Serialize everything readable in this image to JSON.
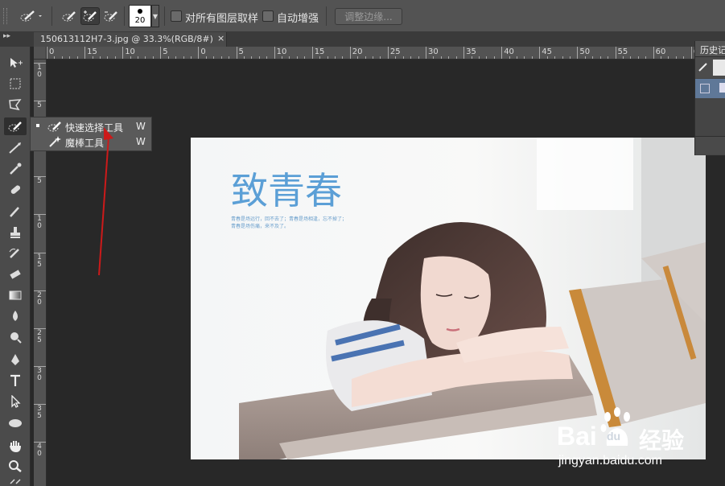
{
  "options_bar": {
    "tool_icon": "quick-selection-brush-icon",
    "modes": [
      "new-selection-icon",
      "add-to-selection-icon",
      "subtract-from-selection-icon"
    ],
    "brush_size": "20",
    "sample_all_layers_label": "对所有图层取样",
    "auto_enhance_label": "自动增强",
    "refine_edge_label": "调整边缘..."
  },
  "document_tab": {
    "title": "150613112H7-3.jpg @ 33.3%(RGB/8#)",
    "close": "×"
  },
  "ruler": {
    "horizontal_labels": [
      "0",
      "15",
      "10",
      "5",
      "0",
      "5",
      "10",
      "15",
      "20",
      "25",
      "30",
      "35",
      "40",
      "45",
      "50",
      "55",
      "60",
      "65"
    ],
    "vertical_labels": [
      "1\n0",
      "5",
      "0",
      "5",
      "1\n0",
      "1\n5",
      "2\n0",
      "2\n5",
      "3\n0",
      "3\n5",
      "4\n0"
    ]
  },
  "toolbar": {
    "tools": [
      "move-icon",
      "marquee-icon",
      "lasso-icon",
      "quick-selection-icon",
      "crop-icon",
      "eyedropper-icon",
      "healing-brush-icon",
      "brush-icon",
      "clone-stamp-icon",
      "history-brush-icon",
      "eraser-icon",
      "gradient-icon",
      "blur-icon",
      "dodge-icon",
      "pen-icon",
      "type-icon",
      "path-selection-icon",
      "ellipse-icon",
      "hand-icon",
      "zoom-icon"
    ]
  },
  "flyout": {
    "items": [
      {
        "label": "快速选择工具",
        "shortcut": "W",
        "icon": "quick-selection-icon",
        "selected": true
      },
      {
        "label": "魔棒工具",
        "shortcut": "W",
        "icon": "magic-wand-icon",
        "selected": false
      }
    ]
  },
  "photo": {
    "title_text": "致青春",
    "subtitle_line1": "青春是场远行，回不去了；青春是场相逢，忘不掉了；",
    "subtitle_line2": "青春是场伤痛，来不及了。"
  },
  "history_panel": {
    "title": "历史记"
  },
  "watermark": {
    "brand": "Bai",
    "paw": "du",
    "jingyan": "经验",
    "url": "jingyan.baidu.com"
  },
  "colors": {
    "annotation_arrow": "#cc1a1a",
    "title_blue": "#5b9fd6"
  }
}
